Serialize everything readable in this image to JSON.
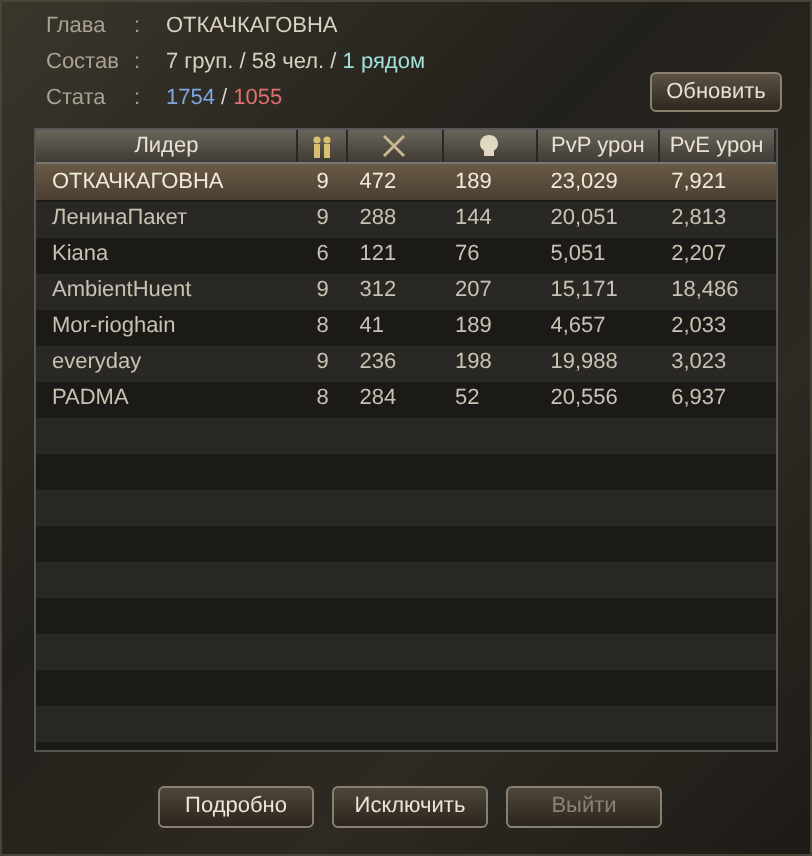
{
  "info": [
    {
      "label": "Глава",
      "separator": ":",
      "value": [
        {
          "text": "ОТКАЧКАГОВНА",
          "kind": "plain"
        }
      ]
    },
    {
      "label": "Состав",
      "separator": ":",
      "value": [
        {
          "text": "7 груп. / 58 чел. / ",
          "kind": "plain"
        },
        {
          "text": "1 рядом",
          "kind": "near"
        }
      ]
    },
    {
      "label": "Стата",
      "separator": ":",
      "value": [
        {
          "text": "1754",
          "kind": "blue"
        },
        {
          "text": " / ",
          "kind": "plain"
        },
        {
          "text": "1055",
          "kind": "red"
        }
      ]
    }
  ],
  "refresh_button": {
    "label": "Обновить"
  },
  "table": {
    "columns": [
      {
        "kind": "text",
        "label": "Лидер"
      },
      {
        "kind": "icon"
      },
      {
        "kind": "icon"
      },
      {
        "kind": "icon"
      },
      {
        "kind": "text",
        "label": "PvP урон"
      },
      {
        "kind": "text",
        "label": "PvE урон"
      }
    ],
    "rows": [
      {
        "selected": true,
        "cells": [
          "ОТКАЧКАГОВНА",
          "9",
          "472",
          "189",
          "23,029",
          "7,921"
        ]
      },
      {
        "selected": false,
        "cells": [
          "ЛенинаПакет",
          "9",
          "288",
          "144",
          "20,051",
          "2,813"
        ]
      },
      {
        "selected": false,
        "cells": [
          "Kiana",
          "6",
          "121",
          "76",
          "5,051",
          "2,207"
        ]
      },
      {
        "selected": false,
        "cells": [
          "AmbientHuent",
          "9",
          "312",
          "207",
          "15,171",
          "18,486"
        ]
      },
      {
        "selected": false,
        "cells": [
          "Mor-rioghain",
          "8",
          "41",
          "189",
          "4,657",
          "2,033"
        ]
      },
      {
        "selected": false,
        "cells": [
          "everyday",
          "9",
          "236",
          "198",
          "19,988",
          "3,023"
        ]
      },
      {
        "selected": false,
        "cells": [
          "PADMA",
          "8",
          "284",
          "52",
          "20,556",
          "6,937"
        ]
      }
    ]
  },
  "buttons": [
    {
      "label": "Подробно",
      "disabled": false
    },
    {
      "label": "Исключить",
      "disabled": false
    },
    {
      "label": "Выйти",
      "disabled": true
    }
  ]
}
